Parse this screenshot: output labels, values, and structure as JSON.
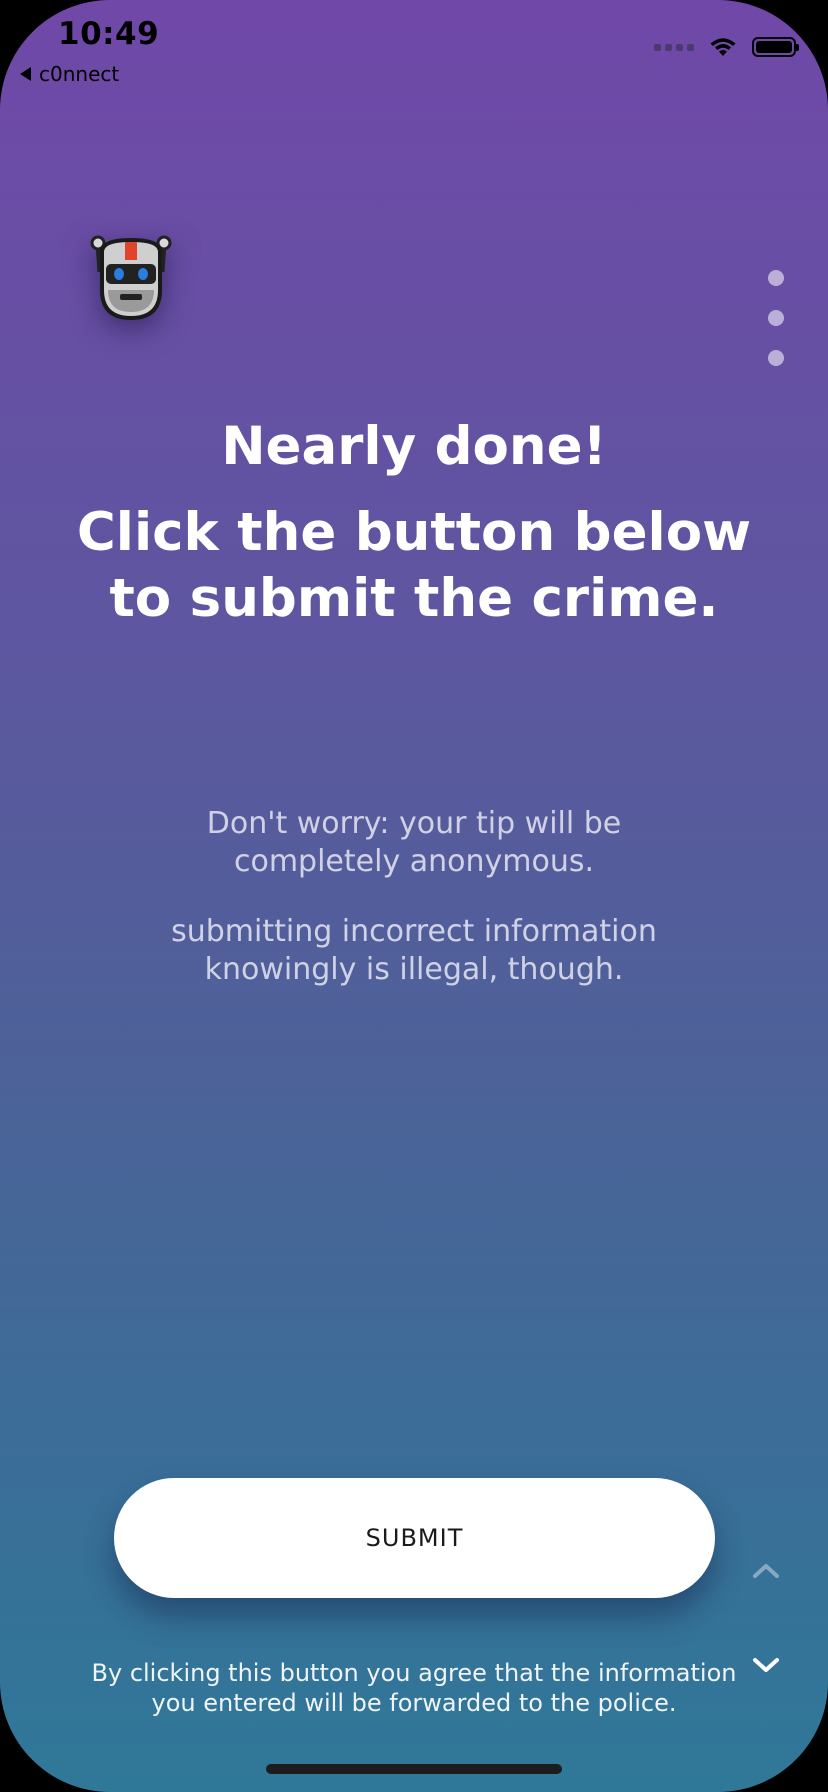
{
  "status_bar": {
    "time": "10:49",
    "back_app": "c0nnect"
  },
  "icons": {
    "robot": "robot-logo-icon",
    "wifi": "wifi-icon",
    "battery": "battery-icon",
    "up": "chevron-up-icon",
    "down": "chevron-down-icon"
  },
  "content": {
    "title": "Nearly done!",
    "subtitle": "Click the button below to submit the crime.",
    "note_anonymous": "Don't worry: your tip will be completely anonymous.",
    "note_illegal": "submitting incorrect information knowingly is illegal, though."
  },
  "actions": {
    "submit_label": "SUBMIT",
    "disclaimer": "By clicking this button you agree that the information you entered will be forwarded to the police."
  },
  "pager": {
    "pages": 3
  },
  "colors": {
    "gradient_top": "#7048a8",
    "gradient_bottom": "#2f7898",
    "button_bg": "#ffffff"
  }
}
